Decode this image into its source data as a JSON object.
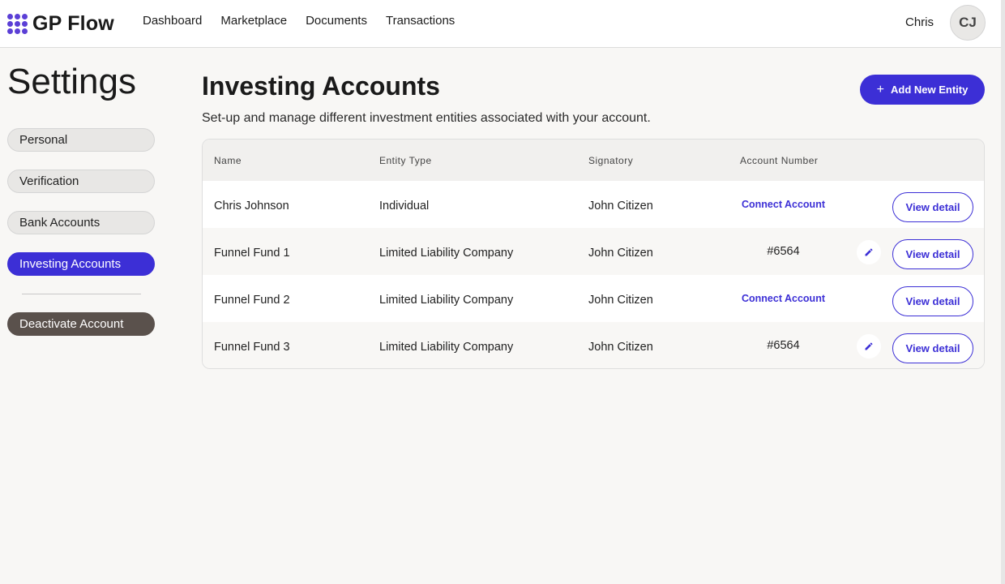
{
  "brand": {
    "name": "GP Flow",
    "accent": "#3c2fd6",
    "logo_icon": "dots-grid-icon"
  },
  "nav": {
    "items": [
      "Dashboard",
      "Marketplace",
      "Documents",
      "Transactions"
    ]
  },
  "user": {
    "name": "Chris",
    "initials": "CJ"
  },
  "sidebar": {
    "title": "Settings",
    "items": [
      {
        "label": "Personal"
      },
      {
        "label": "Verification"
      },
      {
        "label": "Bank Accounts"
      },
      {
        "label": "Investing Accounts",
        "active": true
      }
    ],
    "danger_item": "Deactivate Account"
  },
  "main": {
    "title": "Investing Accounts",
    "subtitle": "Set-up and manage different investment entities associated with your account.",
    "add_button": "Add New Entity",
    "table": {
      "headers": [
        "Name",
        "Entity Type",
        "Signatory",
        "Account Number"
      ],
      "rows": [
        {
          "name": "Chris Johnson",
          "type": "Individual",
          "signatory": "John Citizen",
          "account": "Connect Account",
          "account_is_link": true,
          "editable": false,
          "action": "View detail"
        },
        {
          "name": "Funnel Fund 1",
          "type": "Limited Liability Company",
          "signatory": "John Citizen",
          "account": "#6564",
          "account_is_link": false,
          "editable": true,
          "action": "View detail"
        },
        {
          "name": "Funnel Fund 2",
          "type": "Limited Liability Company",
          "signatory": "John Citizen",
          "account": "Connect Account",
          "account_is_link": true,
          "editable": false,
          "action": "View detail"
        },
        {
          "name": "Funnel Fund 3",
          "type": "Limited Liability Company",
          "signatory": "John Citizen",
          "account": "#6564",
          "account_is_link": false,
          "editable": true,
          "action": "View detail"
        }
      ]
    }
  }
}
